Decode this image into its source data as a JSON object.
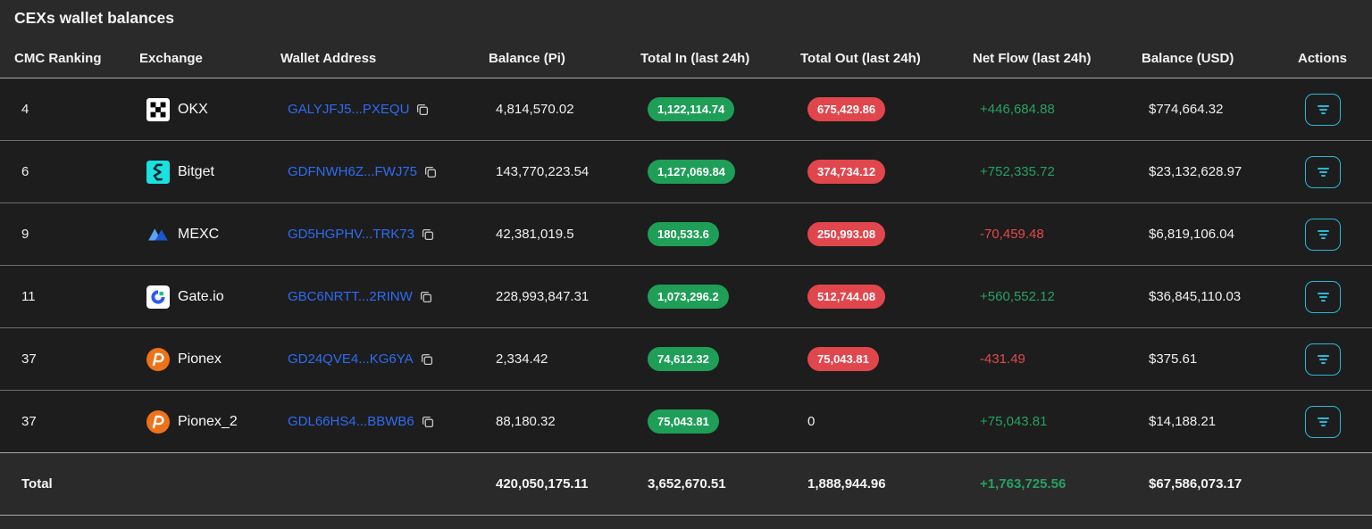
{
  "title": "CEXs wallet balances",
  "columns": [
    "CMC Ranking",
    "Exchange",
    "Wallet Address",
    "Balance (Pi)",
    "Total In (last 24h)",
    "Total Out (last 24h)",
    "Net Flow (last 24h)",
    "Balance (USD)",
    "Actions"
  ],
  "colors": {
    "page_bg": "#2a2a2a",
    "row_bg": "#1d1d1d",
    "badge_green": "#1f9e58",
    "badge_red": "#e2464d",
    "net_flow_positive": "#27a062",
    "net_flow_negative": "#e0494e",
    "address_link": "#2e6bf2",
    "accent_cyan": "#28b8d6"
  },
  "icons": {
    "wallet_copy": "copy-icon",
    "action_button": "filter-icon",
    "exchange_logos": [
      "okx-logo-icon",
      "bitget-logo-icon",
      "mexc-logo-icon",
      "gateio-logo-icon",
      "pionex-logo-icon"
    ]
  },
  "rows": [
    {
      "cmc_ranking": "4",
      "exchange": "OKX",
      "logo": "okx",
      "wallet_address": "GALYJFJ5...PXEQU",
      "balance_pi": "4,814,570.02",
      "total_in": "1,122,114.74",
      "total_out": "675,429.86",
      "total_out_badge": true,
      "net_flow": "+446,684.88",
      "net_flow_direction": "positive",
      "balance_usd": "$774,664.32"
    },
    {
      "cmc_ranking": "6",
      "exchange": "Bitget",
      "logo": "bitget",
      "wallet_address": "GDFNWH6Z...FWJ75",
      "balance_pi": "143,770,223.54",
      "total_in": "1,127,069.84",
      "total_out": "374,734.12",
      "total_out_badge": true,
      "net_flow": "+752,335.72",
      "net_flow_direction": "positive",
      "balance_usd": "$23,132,628.97"
    },
    {
      "cmc_ranking": "9",
      "exchange": "MEXC",
      "logo": "mexc",
      "wallet_address": "GD5HGPHV...TRK73",
      "balance_pi": "42,381,019.5",
      "total_in": "180,533.6",
      "total_out": "250,993.08",
      "total_out_badge": true,
      "net_flow": "-70,459.48",
      "net_flow_direction": "negative",
      "balance_usd": "$6,819,106.04"
    },
    {
      "cmc_ranking": "11",
      "exchange": "Gate.io",
      "logo": "gateio",
      "wallet_address": "GBC6NRTT...2RINW",
      "balance_pi": "228,993,847.31",
      "total_in": "1,073,296.2",
      "total_out": "512,744.08",
      "total_out_badge": true,
      "net_flow": "+560,552.12",
      "net_flow_direction": "positive",
      "balance_usd": "$36,845,110.03"
    },
    {
      "cmc_ranking": "37",
      "exchange": "Pionex",
      "logo": "pionex",
      "wallet_address": "GD24QVE4...KG6YA",
      "balance_pi": "2,334.42",
      "total_in": "74,612.32",
      "total_out": "75,043.81",
      "total_out_badge": true,
      "net_flow": "-431.49",
      "net_flow_direction": "negative",
      "balance_usd": "$375.61"
    },
    {
      "cmc_ranking": "37",
      "exchange": "Pionex_2",
      "logo": "pionex",
      "wallet_address": "GDL66HS4...BBWB6",
      "balance_pi": "88,180.32",
      "total_in": "75,043.81",
      "total_out": "0",
      "total_out_badge": false,
      "net_flow": "+75,043.81",
      "net_flow_direction": "positive",
      "balance_usd": "$14,188.21"
    }
  ],
  "total": {
    "label": "Total",
    "balance_pi": "420,050,175.11",
    "total_in": "3,652,670.51",
    "total_out": "1,888,944.96",
    "net_flow": "+1,763,725.56",
    "net_flow_direction": "positive",
    "balance_usd": "$67,586,073.17"
  }
}
